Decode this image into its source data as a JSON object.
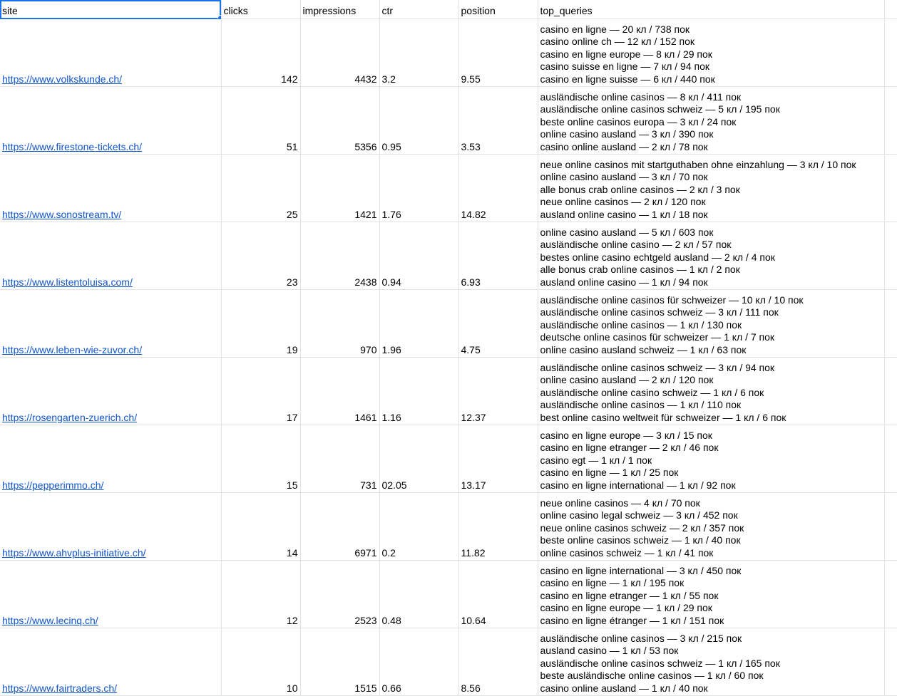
{
  "headers": {
    "site": "site",
    "clicks": "clicks",
    "impressions": "impressions",
    "ctr": "ctr",
    "position": "position",
    "top_queries": "top_queries"
  },
  "rows": [
    {
      "site": "https://www.volkskunde.ch/",
      "clicks": "142",
      "impressions": "4432",
      "ctr": "3.2",
      "position": "9.55",
      "queries": [
        "casino en ligne — 20 кл / 738 пок",
        "casino online ch — 12 кл / 152 пок",
        "casino en ligne europe — 8 кл / 29 пок",
        "casino suisse en ligne — 7 кл / 94 пок",
        "casino en ligne suisse — 6 кл / 440 пок"
      ]
    },
    {
      "site": "https://www.firestone-tickets.ch/",
      "clicks": "51",
      "impressions": "5356",
      "ctr": "0.95",
      "position": "3.53",
      "queries": [
        "ausländische online casinos — 8 кл / 411 пок",
        "ausländische online casinos schweiz — 5 кл / 195 пок",
        "beste online casinos europa — 3 кл / 24 пок",
        "online casino ausland — 3 кл / 390 пок",
        "casino online ausland — 2 кл / 78 пок"
      ]
    },
    {
      "site": "https://www.sonostream.tv/",
      "clicks": "25",
      "impressions": "1421",
      "ctr": "1.76",
      "position": "14.82",
      "queries": [
        "neue online casinos mit startguthaben ohne einzahlung — 3 кл / 10 пок",
        "online casino ausland — 3 кл / 70 пок",
        "alle bonus crab online casinos — 2 кл / 3 пок",
        "neue online casinos — 2 кл / 120 пок",
        "ausland online casino — 1 кл / 18 пок"
      ]
    },
    {
      "site": "https://www.listentoluisa.com/",
      "clicks": "23",
      "impressions": "2438",
      "ctr": "0.94",
      "position": "6.93",
      "queries": [
        "online casino ausland — 5 кл / 603 пок",
        "ausländische online casino — 2 кл / 57 пок",
        "bestes online casino echtgeld ausland — 2 кл / 4 пок",
        "alle bonus crab online casinos — 1 кл / 2 пок",
        "ausland online casino — 1 кл / 94 пок"
      ]
    },
    {
      "site": "https://www.leben-wie-zuvor.ch/",
      "clicks": "19",
      "impressions": "970",
      "ctr": "1.96",
      "position": "4.75",
      "queries": [
        "ausländische online casinos für schweizer — 10 кл / 10 пок",
        "ausländische online casinos schweiz — 3 кл / 111 пок",
        "ausländische online casinos — 1 кл / 130 пок",
        "deutsche online casinos für schweizer — 1 кл / 7 пок",
        "online casino ausland schweiz — 1 кл / 63 пок"
      ]
    },
    {
      "site": "https://rosengarten-zuerich.ch/",
      "clicks": "17",
      "impressions": "1461",
      "ctr": "1.16",
      "position": "12.37",
      "queries": [
        "ausländische online casinos schweiz — 3 кл / 94 пок",
        "online casino ausland — 2 кл / 120 пок",
        "ausländische online casino schweiz — 1 кл / 6 пок",
        "ausländische online casinos — 1 кл / 110 пок",
        "best online casino weltweit für schweizer — 1 кл / 6 пок"
      ]
    },
    {
      "site": "https://pepperimmo.ch/",
      "clicks": "15",
      "impressions": "731",
      "ctr": "02.05",
      "position": "13.17",
      "queries": [
        "casino en ligne europe — 3 кл / 15 пок",
        "casino en ligne etranger — 2 кл / 46 пок",
        "casino egt — 1 кл / 1 пок",
        "casino en ligne — 1 кл / 25 пок",
        "casino en ligne international — 1 кл / 92 пок"
      ]
    },
    {
      "site": "https://www.ahvplus-initiative.ch/",
      "clicks": "14",
      "impressions": "6971",
      "ctr": "0.2",
      "position": "11.82",
      "queries": [
        "neue online casinos — 4 кл / 70 пок",
        "online casino legal schweiz — 3 кл / 452 пок",
        "neue online casinos schweiz — 2 кл / 357 пок",
        "beste online casinos schweiz — 1 кл / 40 пок",
        "online casinos schweiz — 1 кл / 41 пок"
      ]
    },
    {
      "site": "https://www.lecinq.ch/",
      "clicks": "12",
      "impressions": "2523",
      "ctr": "0.48",
      "position": "10.64",
      "queries": [
        "casino en ligne international — 3 кл / 450 пок",
        "casino en ligne — 1 кл / 195 пок",
        "casino en ligne etranger — 1 кл / 55 пок",
        "casino en ligne europe — 1 кл / 29 пок",
        "casino en ligne étranger — 1 кл / 151 пок"
      ]
    },
    {
      "site": "https://www.fairtraders.ch/",
      "clicks": "10",
      "impressions": "1515",
      "ctr": "0.66",
      "position": "8.56",
      "queries": [
        "ausländische online casinos — 3 кл / 215 пок",
        "ausland casino — 1 кл / 53 пок",
        "ausländische online casinos schweiz — 1 кл / 165 пок",
        "beste ausländische online casinos — 1 кл / 60 пок",
        "casino online ausland — 1 кл / 40 пок"
      ]
    }
  ]
}
